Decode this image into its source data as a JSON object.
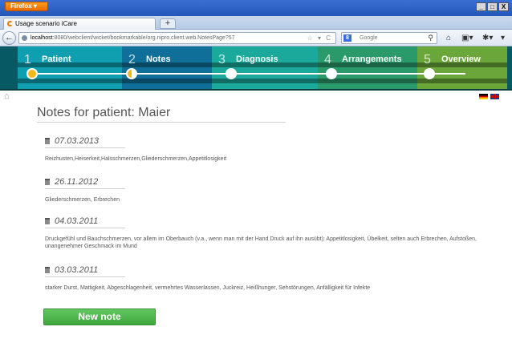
{
  "browser": {
    "app_button": "Firefox",
    "window_controls": [
      "_",
      "□",
      "X"
    ],
    "tab_title": "Usage scenario iCare",
    "new_tab": "+",
    "url_host": "localhost",
    "url_rest": ":8080/webclient/wicket/bookmarkable/org.nipro.client.web.NotesPage?57",
    "search_placeholder": "Google"
  },
  "wizard": {
    "steps": [
      {
        "num": "1",
        "label": "Patient"
      },
      {
        "num": "2",
        "label": "Notes"
      },
      {
        "num": "3",
        "label": "Diagnosis"
      },
      {
        "num": "4",
        "label": "Arrangements"
      },
      {
        "num": "5",
        "label": "Overview"
      }
    ],
    "colors": [
      "#0f9fb0",
      "#0f6f98",
      "#1aa99a",
      "#2a9a6a",
      "#6aa63a"
    ]
  },
  "page": {
    "title": "Notes for patient: Maier"
  },
  "notes": [
    {
      "date": "07.03.2013",
      "text": "Reizhusten,Heiserkeit,Halsschmerzen,Gliederschmerzen,Appetitlosigkeit"
    },
    {
      "date": "26.11.2012",
      "text": "Gliederschmerzen, Erbrechen"
    },
    {
      "date": "04.03.2011",
      "text": "Druckgefühl und Bauchschmerzen, vor allem im Oberbauch (v.a., wenn man mit der Hand Druck auf ihn ausübt); Appetitlosigkeit, Übelkeit, selten auch Erbrechen, Aufstoßen, unangenehmer Geschmack im Mund"
    },
    {
      "date": "03.03.2011",
      "text": "starker Durst, Mattigkeit, Abgeschlagenheit, vermehrtes Wasserlassen, Juckreiz, Heißhunger, Sehstörungen, Anfälligkeit für Infekte"
    }
  ],
  "actions": {
    "new_note": "New note"
  }
}
